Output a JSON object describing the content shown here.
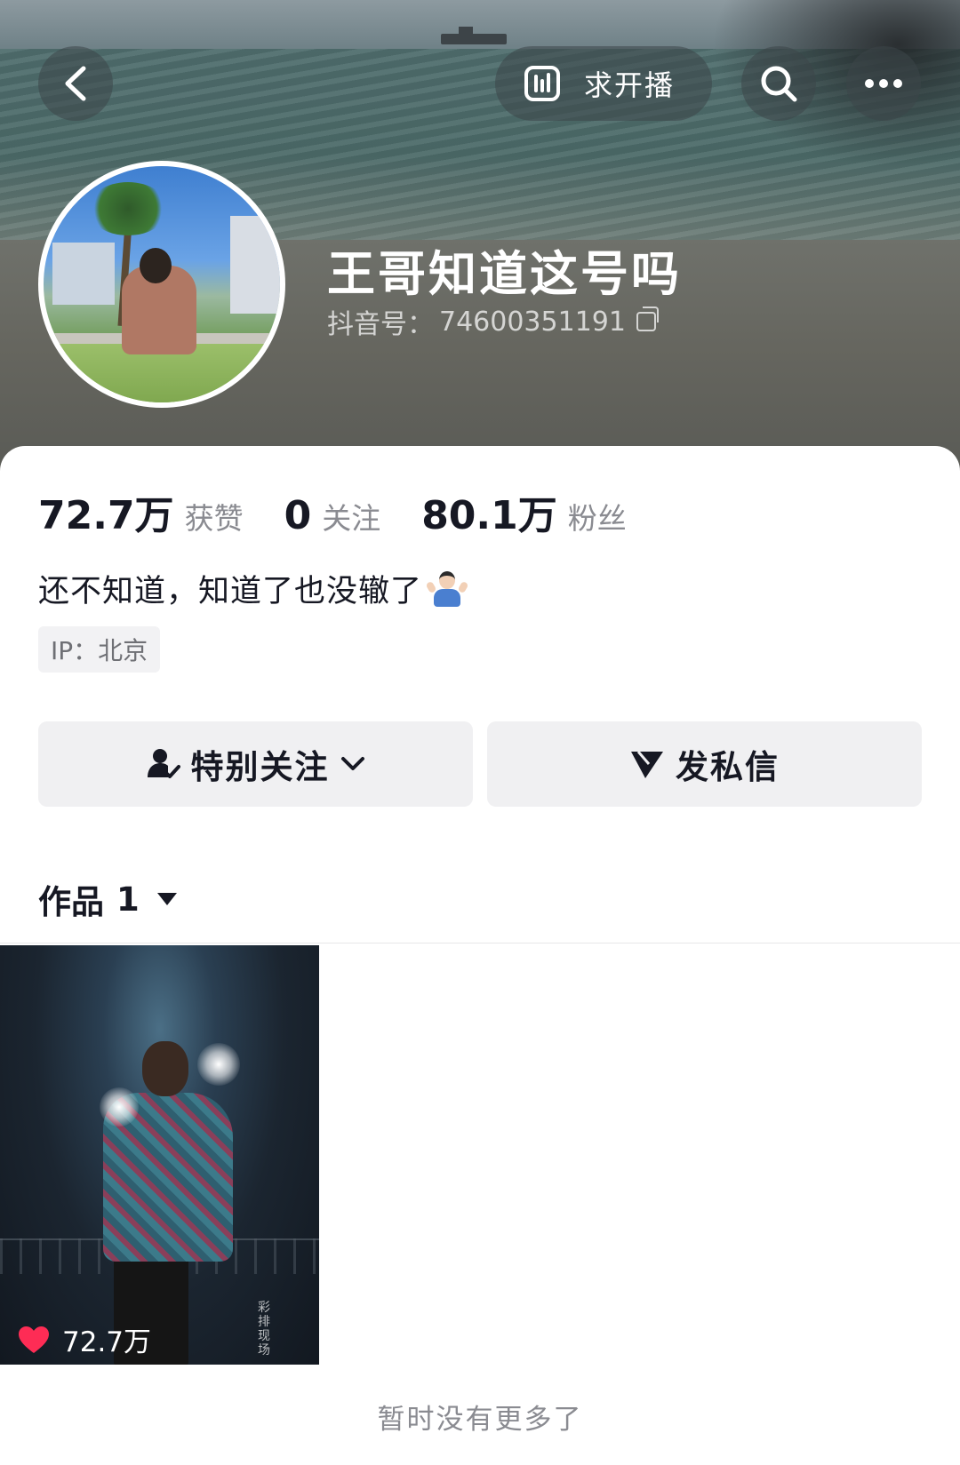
{
  "header": {
    "live_request_label": "求开播"
  },
  "profile": {
    "username": "王哥知道这号吗",
    "douyin_id_label": "抖音号：",
    "douyin_id": "74600351191"
  },
  "stats": [
    {
      "value": "72.7万",
      "label": "获赞"
    },
    {
      "value": "0",
      "label": "关注"
    },
    {
      "value": "80.1万",
      "label": "粉丝"
    }
  ],
  "bio": "还不知道，知道了也没辙了",
  "ip_location": "IP：北京",
  "actions": {
    "follow_label": "特别关注",
    "message_label": "发私信"
  },
  "works_tab": {
    "label": "作品",
    "count": "1"
  },
  "videos": [
    {
      "likes": "72.7万",
      "watermark": "彩排现场"
    }
  ],
  "footer": "暂时没有更多了",
  "colors": {
    "primary_text": "#161823",
    "secondary_text": "#8a8b91",
    "button_bg": "#f0f0f2",
    "like_red": "#fe2c55"
  }
}
